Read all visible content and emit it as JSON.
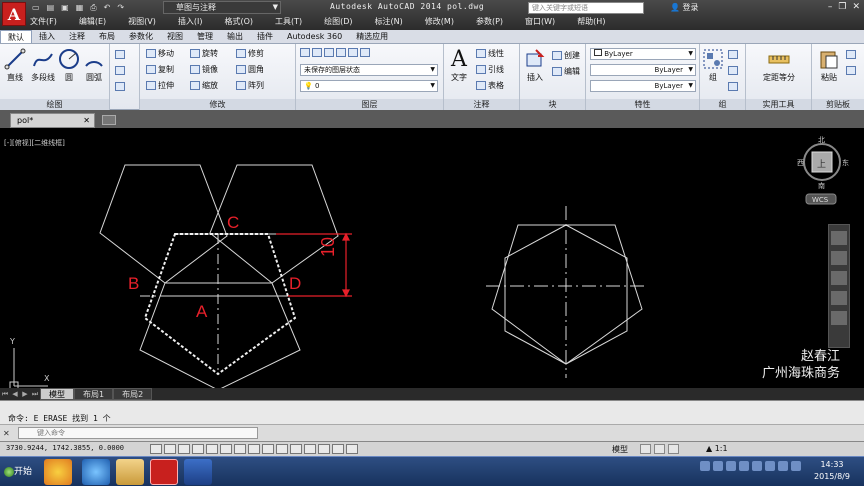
{
  "titlebar": {
    "logo": "A",
    "workspace": "草图与注释",
    "window_title": "Autodesk AutoCAD 2014    pol.dwg",
    "search_placeholder": "键入关键字或短语",
    "login": "登录",
    "menu": [
      "文件(F)",
      "编辑(E)",
      "视图(V)",
      "插入(I)",
      "格式(O)",
      "工具(T)",
      "绘图(D)",
      "标注(N)",
      "修改(M)",
      "参数(P)",
      "窗口(W)",
      "帮助(H)"
    ]
  },
  "ribbon": {
    "tabs": [
      "默认",
      "插入",
      "注释",
      "布局",
      "参数化",
      "视图",
      "管理",
      "输出",
      "插件",
      "Autodesk 360",
      "精选应用"
    ],
    "draw": {
      "title": "绘图",
      "line": "直线",
      "polyline": "多段线",
      "circle": "圆",
      "arc": "圆弧"
    },
    "modify": {
      "title": "修改",
      "move": "移动",
      "rotate": "旋转",
      "trim": "修剪",
      "copy": "复制",
      "mirror": "镜像",
      "fillet": "圆角",
      "stretch": "拉伸",
      "scale": "缩放",
      "array": "阵列"
    },
    "layers": {
      "title": "图层",
      "state": "未保存的图层状态",
      "current": "0"
    },
    "annotation": {
      "title": "注释",
      "text": "文字",
      "linear": "线性",
      "leader": "引线",
      "table": "表格"
    },
    "block": {
      "title": "块",
      "insert": "插入",
      "create": "创建",
      "edit": "编辑"
    },
    "properties": {
      "title": "特性",
      "color": "ByLayer",
      "linetype": "ByLayer",
      "lineweight": "ByLayer"
    },
    "groups": {
      "title": "组",
      "group": "组"
    },
    "utilities": {
      "title": "实用工具",
      "measure": "定距等分"
    },
    "clipboard": {
      "title": "剪贴板",
      "paste": "粘贴"
    }
  },
  "document": {
    "tab": "pol*"
  },
  "drawing": {
    "viewport_label": "[-][俯视][二维线框]",
    "labels": {
      "a": "A",
      "b": "B",
      "c": "C",
      "d": "D",
      "dim": "10"
    },
    "viewcube": {
      "north": "北",
      "south": "南",
      "west": "西",
      "east": "东",
      "top": "上",
      "wcs": "WCS"
    },
    "watermark": [
      "赵春江",
      "广州海珠商务"
    ],
    "ucs": {
      "x": "X",
      "y": "Y"
    }
  },
  "layout_tabs": [
    "模型",
    "布局1",
    "布局2"
  ],
  "command": {
    "history": "命令: E ERASE 找到 1 个",
    "placeholder": "键入命令"
  },
  "status": {
    "coords": "3730.9244, 1742.3855, 0.0000",
    "model": "模型",
    "scale": "1:1"
  },
  "taskbar": {
    "start": "开始",
    "time": "14:33",
    "date": "2015/8/9"
  },
  "colors": {
    "accent_red": "#e8202a",
    "autocad_red": "#c8201e"
  }
}
